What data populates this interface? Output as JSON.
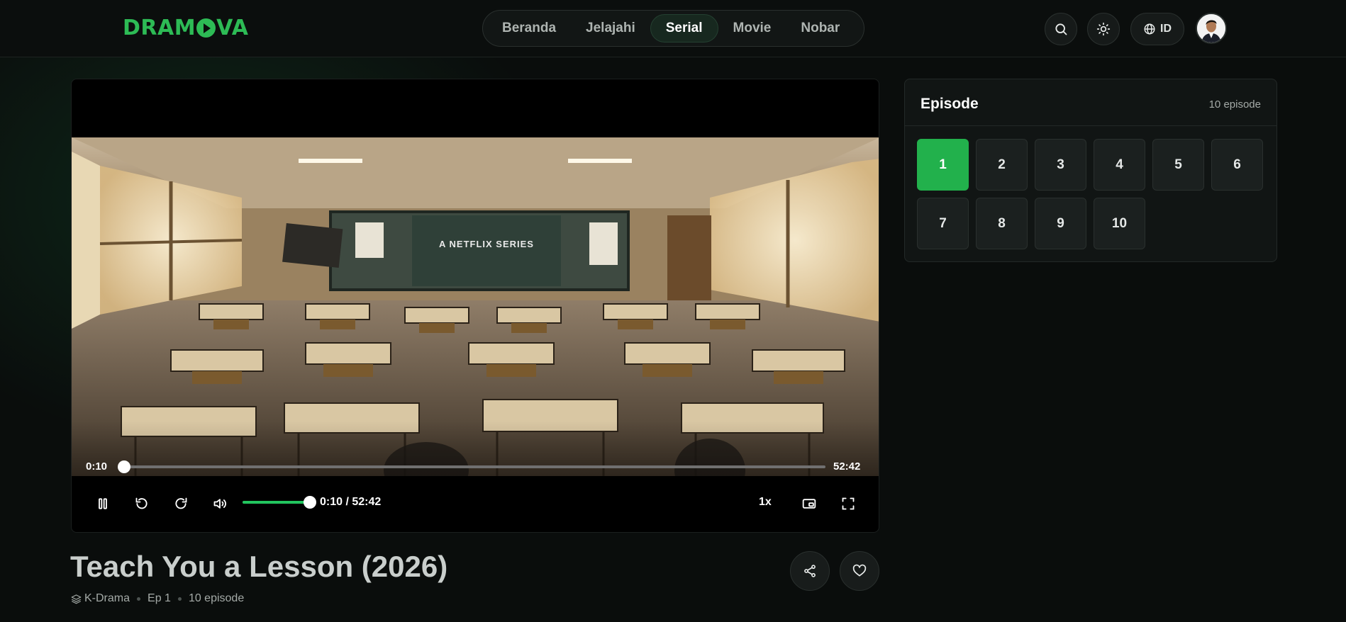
{
  "header": {
    "logo": {
      "left": "DRAM",
      "right": "VA"
    },
    "nav": [
      {
        "label": "Beranda",
        "active": false
      },
      {
        "label": "Jelajahi",
        "active": false
      },
      {
        "label": "Serial",
        "active": true
      },
      {
        "label": "Movie",
        "active": false
      },
      {
        "label": "Nobar",
        "active": false
      }
    ],
    "language": "ID",
    "icons": [
      "search-icon",
      "sun-icon",
      "globe-icon"
    ]
  },
  "player": {
    "watermark": "A NETFLIX SERIES",
    "current_time": "0:10",
    "duration": "52:42",
    "time_combo": "0:10 / 52:42",
    "progress": 0.003,
    "volume": 1.0,
    "speed": "1x"
  },
  "show": {
    "title": "Teach You a Lesson (2026)",
    "genre": "K-Drama",
    "episode": "Ep 1",
    "episode_count": "10 episode"
  },
  "episodes": {
    "title": "Episode",
    "count": "10 episode",
    "items": [
      "1",
      "2",
      "3",
      "4",
      "5",
      "6",
      "7",
      "8",
      "9",
      "10"
    ],
    "active": "1"
  },
  "colors": {
    "accent": "#22b14c",
    "logo": "#2dbb55",
    "background": "#0a0d0c"
  }
}
